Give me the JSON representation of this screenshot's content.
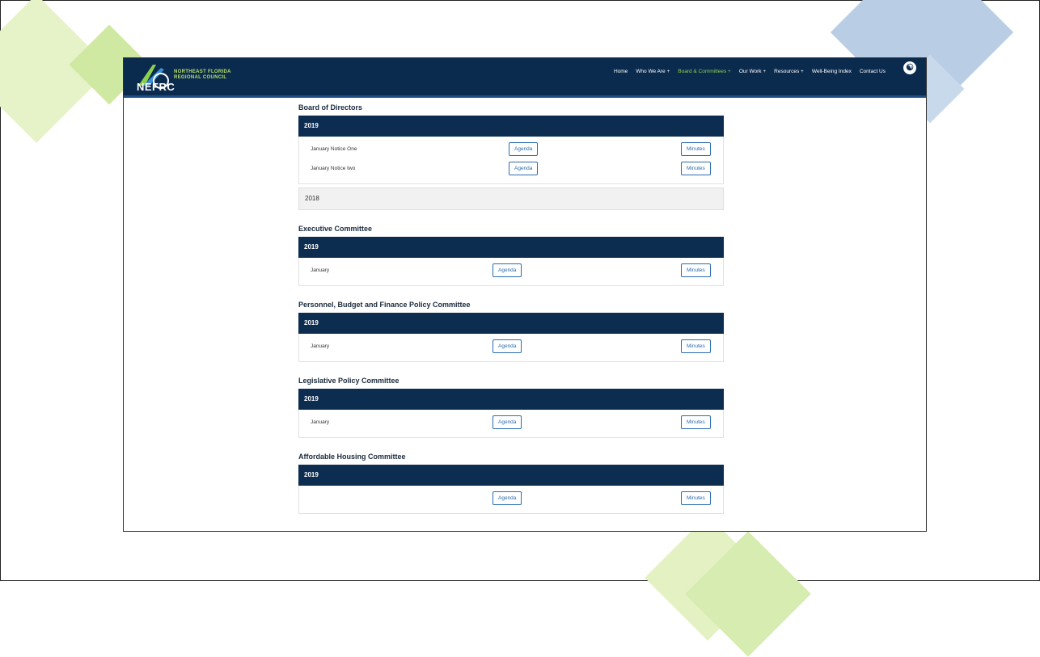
{
  "header": {
    "logo_short": "NEFRC",
    "logo_name_line1": "NORTHEAST FLORIDA",
    "logo_name_line2": "REGIONAL COUNCIL",
    "nav": [
      {
        "label": "Home",
        "active": false
      },
      {
        "label": "Who We Are +",
        "active": false
      },
      {
        "label": "Board & Committees +",
        "active": true
      },
      {
        "label": "Our Work +",
        "active": false
      },
      {
        "label": "Resources +",
        "active": false
      },
      {
        "label": "Well-Being Index",
        "active": false
      },
      {
        "label": "Contact Us",
        "active": false
      }
    ],
    "accessibility_icon": "accessibility-icon",
    "active_color": "#8dd04f",
    "bar_color": "#0a2a4e"
  },
  "committees": [
    {
      "title": "Board of Directors",
      "open_year": "2019",
      "rows": [
        {
          "label": "January Notice One",
          "agenda": "Agenda",
          "minutes": "Minutes"
        },
        {
          "label": "January Notice two",
          "agenda": "Agenda",
          "minutes": "Minutes"
        }
      ],
      "collapsed_year": "2018"
    },
    {
      "title": "Executive Committee",
      "open_year": "2019",
      "rows": [
        {
          "label": "January",
          "agenda": "Agenda",
          "minutes": "Minutes"
        }
      ]
    },
    {
      "title": "Personnel, Budget and Finance Policy Committee",
      "open_year": "2019",
      "rows": [
        {
          "label": "January",
          "agenda": "Agenda",
          "minutes": "Minutes"
        }
      ]
    },
    {
      "title": "Legislative Policy Committee",
      "open_year": "2019",
      "rows": [
        {
          "label": "January",
          "agenda": "Agenda",
          "minutes": "Minutes"
        }
      ]
    },
    {
      "title": "Affordable Housing Committee",
      "open_year": "2019",
      "rows": [
        {
          "label": "",
          "agenda": "Agenda",
          "minutes": "Minutes"
        }
      ]
    }
  ]
}
